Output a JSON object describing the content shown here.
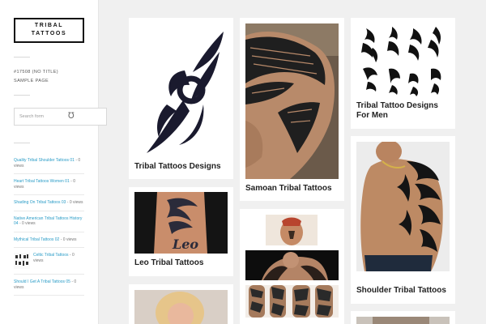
{
  "site": {
    "logo_line1": "TRIBAL",
    "logo_line2": "TATTOOS"
  },
  "menu": {
    "items": [
      "#17508 (NO TITLE)",
      "SAMPLE PAGE"
    ]
  },
  "search": {
    "placeholder": "Search form"
  },
  "popular": [
    {
      "title": "Quality Tribal Shoulder Tattoos 01",
      "views": " - 0 views"
    },
    {
      "title": "Heart Tribal Tattoos Women 01",
      "views": " - 0 views"
    },
    {
      "title": "Shading On Tribal Tattoos 03",
      "views": " - 0 views"
    },
    {
      "title": "Native American Tribal Tattoos History 04",
      "views": " - 0 views"
    },
    {
      "title": "Mythical Tribal Tattoos 02",
      "views": " - 0 views"
    },
    {
      "title": "Celtic Tribal Tattoos",
      "views": " - 0 views"
    },
    {
      "title": "Should I Get A Tribal Tattoos 05",
      "views": " - 0 views"
    }
  ],
  "posts": {
    "p1": "Tribal Tattoos Designs",
    "p2": "Leo Tribal Tattoos",
    "p3": "Samoan Tribal Tattoos",
    "p4": "Tribal Tattoo Designs For Men",
    "p5": "Shoulder Tribal Tattoos"
  },
  "colors": {
    "link": "#2a9cc7",
    "background": "#f0f0f0",
    "card": "#ffffff"
  }
}
